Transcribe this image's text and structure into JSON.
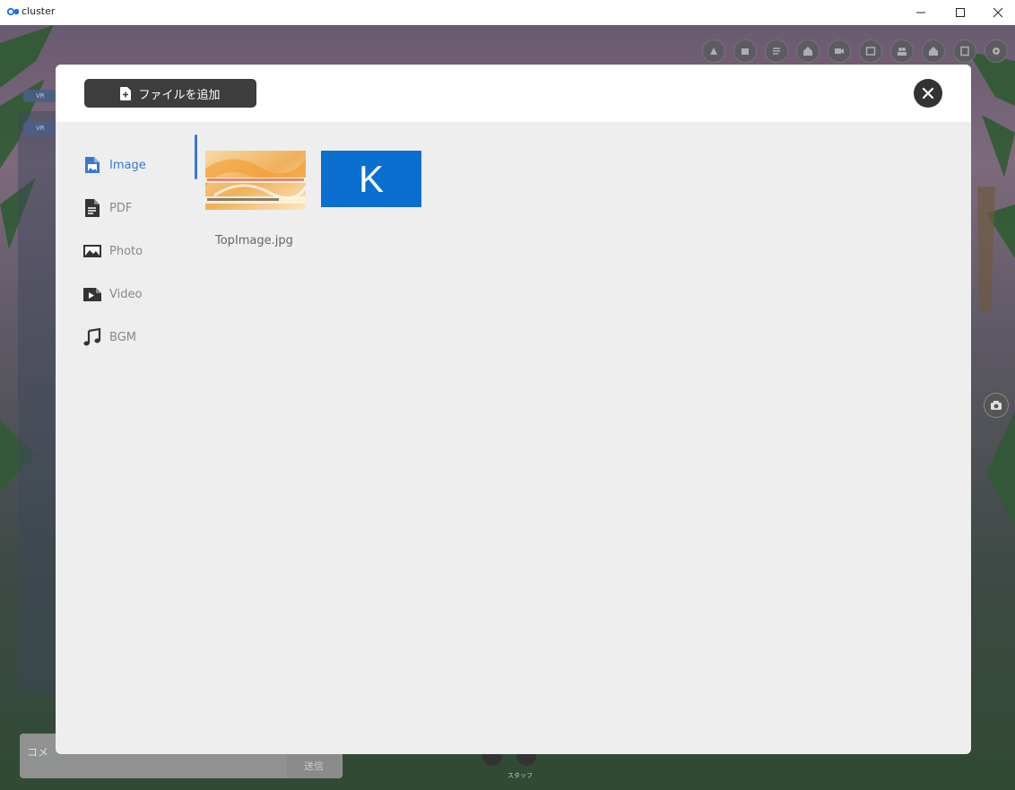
{
  "window": {
    "title": "cluster",
    "minimize_glyph": "—",
    "maximize_glyph": "☐",
    "close_glyph": "✕"
  },
  "modal": {
    "add_file_label": "ファイルを追加",
    "categories": [
      {
        "label": "Image",
        "icon": "image-file-icon",
        "active": true
      },
      {
        "label": "PDF",
        "icon": "pdf-file-icon",
        "active": false
      },
      {
        "label": "Photo",
        "icon": "photo-icon",
        "active": false
      },
      {
        "label": "Video",
        "icon": "video-icon",
        "active": false
      },
      {
        "label": "BGM",
        "icon": "music-note-icon",
        "active": false
      }
    ],
    "files": [
      {
        "name": "TopImage.jpg",
        "thumbnail": "orange-collage-image"
      },
      {
        "name": "",
        "thumbnail_text": "K",
        "thumbnail_color": "#0a6fcf"
      }
    ],
    "accent_color": "#3a78d0"
  },
  "scene": {
    "chips": [
      "VR",
      "VR"
    ],
    "comment_placeholder": "コメ",
    "send_label": "送信",
    "staff_label": "スタッフ"
  }
}
